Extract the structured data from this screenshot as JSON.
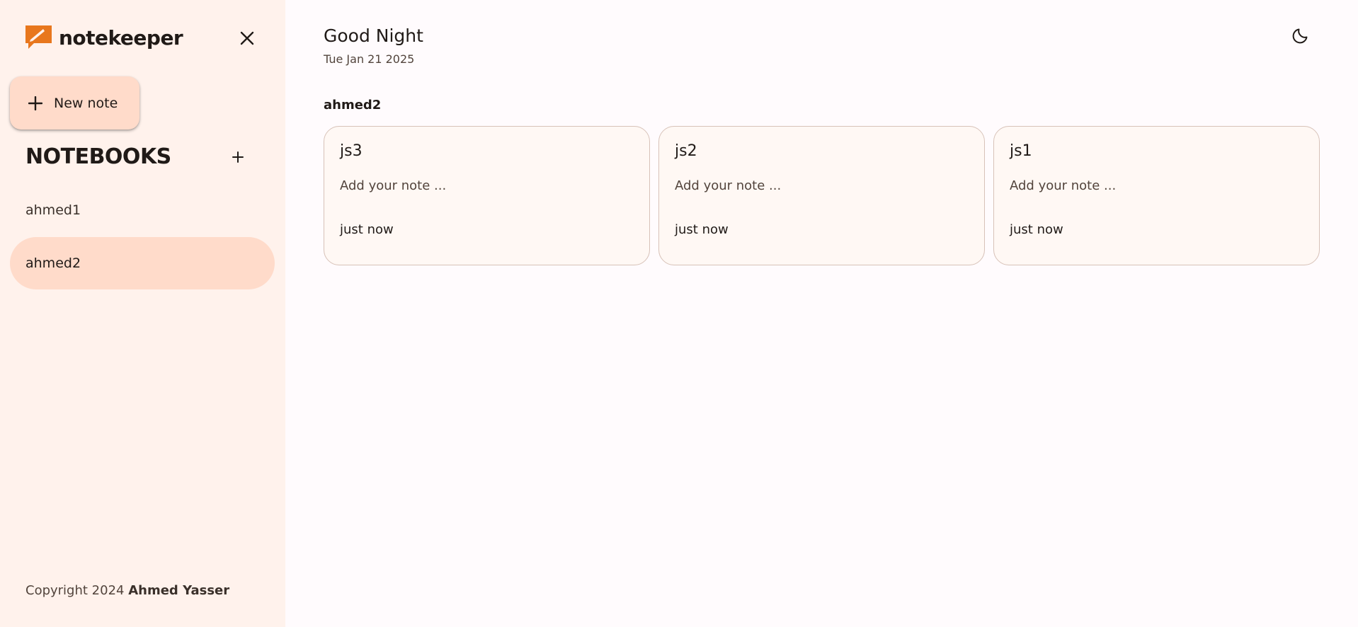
{
  "brand": {
    "name": "notekeeper",
    "accent": "#e8771d"
  },
  "sidebar": {
    "new_note_label": "New note",
    "notebooks_title": "NOTEBOOKS",
    "notebooks": [
      {
        "label": "ahmed1",
        "active": false
      },
      {
        "label": "ahmed2",
        "active": true
      }
    ],
    "copyright_prefix": "Copyright 2024",
    "copyright_author": "Ahmed Yasser"
  },
  "header": {
    "greeting": "Good Night",
    "date": "Tue Jan 21 2025"
  },
  "main": {
    "notebook_title": "ahmed2",
    "notes": [
      {
        "title": "js3",
        "body": "Add your note ...",
        "time": "just now"
      },
      {
        "title": "js2",
        "body": "Add your note ...",
        "time": "just now"
      },
      {
        "title": "js1",
        "body": "Add your note ...",
        "time": "just now"
      }
    ]
  },
  "icons": {
    "close": "close-icon",
    "add": "plus-icon",
    "theme": "moon-icon"
  },
  "colors": {
    "sidebar_bg": "#fff2ec",
    "active_bg": "#ffdbca",
    "main_bg": "#fffbfd",
    "card_bg": "#fff8f4",
    "card_border": "#d7c2b8"
  }
}
